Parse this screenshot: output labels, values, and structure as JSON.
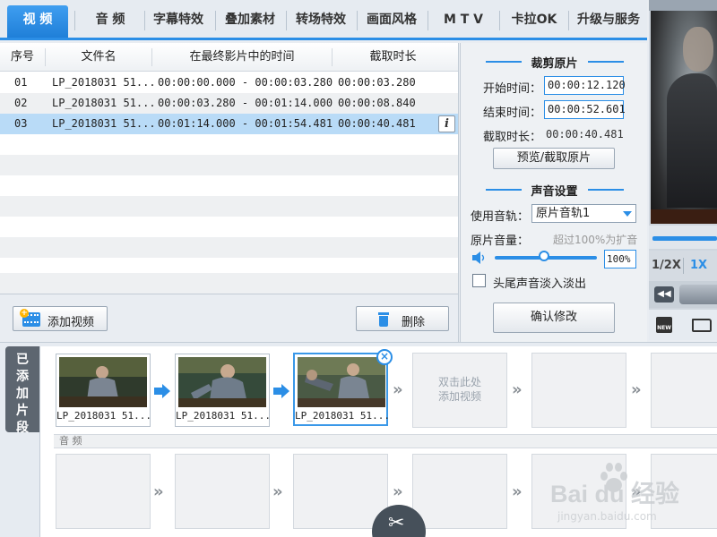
{
  "tabs": [
    {
      "label": "视  频",
      "active": true
    },
    {
      "label": "音  频"
    },
    {
      "label": "字幕特效"
    },
    {
      "label": "叠加素材"
    },
    {
      "label": "转场特效"
    },
    {
      "label": "画面风格"
    },
    {
      "label": "M T V"
    },
    {
      "label": "卡拉OK"
    },
    {
      "label": "升级与服务"
    }
  ],
  "table": {
    "headers": [
      "序号",
      "文件名",
      "在最终影片中的时间",
      "截取时长"
    ],
    "rows": [
      {
        "index": "01",
        "file": "LP_2018031 51...",
        "range": "00:00:00.000 - 00:00:03.280",
        "duration": "00:00:03.280"
      },
      {
        "index": "02",
        "file": "LP_2018031 51...",
        "range": "00:00:03.280 - 00:01:14.000",
        "duration": "00:00:08.840"
      },
      {
        "index": "03",
        "file": "LP_2018031 51...",
        "range": "00:01:14.000 - 00:01:54.481",
        "duration": "00:00:40.481"
      }
    ],
    "info_glyph": "i"
  },
  "buttons": {
    "add_video": "添加视频",
    "delete": "删除",
    "preview_cut": "预览/截取原片",
    "confirm": "确认修改"
  },
  "trim": {
    "title": "裁剪原片",
    "start_label": "开始时间：",
    "start_value": "00:00:12.120",
    "end_label": "结束时间：",
    "end_value": "00:00:52.601",
    "duration_label": "截取时长：",
    "duration_value": "00:00:40.481"
  },
  "sound": {
    "title": "声音设置",
    "track_label": "使用音轨：",
    "track_value": "原片音轨1",
    "volume_label": "原片音量：",
    "volume_hint": "超过100%为扩音",
    "volume_value": "100%",
    "volume_fraction": 0.5,
    "fade_label": "头尾声音淡入淡出",
    "fade_checked": false
  },
  "preview": {
    "speed_half": "1/2X",
    "speed_one": "1X",
    "new_icon_text": "NEW"
  },
  "strip": {
    "side_tab": "已添加片段",
    "clips": [
      {
        "caption": "LP_2018031 51..."
      },
      {
        "caption": "LP_2018031 51..."
      },
      {
        "caption": "LP_2018031 51..."
      }
    ],
    "empty_hint": "双击此处\n添加视频",
    "audio_label": "音  频"
  },
  "watermark": {
    "brand": "Bai du 经验",
    "site": "jingyan.baidu.com"
  },
  "colors": {
    "accent": "#2b8ee6",
    "selected_row": "#b9dbf7",
    "side_tab": "#5d6670"
  }
}
